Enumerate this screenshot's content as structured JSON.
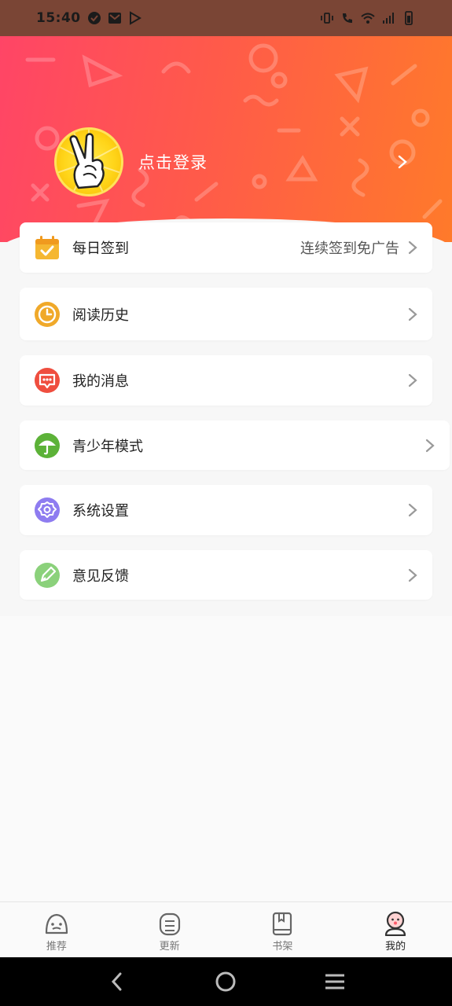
{
  "status_bar": {
    "time": "15:40",
    "left_icons": [
      "check-circle-icon",
      "mail-icon",
      "play-store-icon"
    ],
    "right_icons": [
      "vibrate-icon",
      "wifi-call-icon",
      "wifi-icon",
      "signal-icon",
      "battery-icon"
    ]
  },
  "header": {
    "login_text": "点击登录",
    "avatar": "peace-hand-avatar",
    "gradient_start": "#ff4566",
    "gradient_end": "#ff7a2a"
  },
  "menu": [
    {
      "label": "每日签到",
      "sub": "连续签到免广告",
      "icon": "calendar-check-icon",
      "color": "#f5b731"
    },
    {
      "label": "阅读历史",
      "sub": "",
      "icon": "clock-icon",
      "color": "#f0a92a"
    },
    {
      "label": "我的消息",
      "sub": "",
      "icon": "message-icon",
      "color": "#ef4e3f"
    },
    {
      "label": "青少年模式",
      "sub": "",
      "icon": "umbrella-icon",
      "color": "#5cb238"
    },
    {
      "label": "系统设置",
      "sub": "",
      "icon": "gear-icon",
      "color": "#8e7cf0"
    },
    {
      "label": "意见反馈",
      "sub": "",
      "icon": "feedback-icon",
      "color": "#8bd17b"
    }
  ],
  "tabs": [
    {
      "label": "推荐",
      "icon": "recommend-icon",
      "active": false
    },
    {
      "label": "更新",
      "icon": "update-icon",
      "active": false
    },
    {
      "label": "书架",
      "icon": "bookshelf-icon",
      "active": false
    },
    {
      "label": "我的",
      "icon": "profile-icon",
      "active": true
    }
  ],
  "nav": [
    "back-icon",
    "home-icon",
    "recents-icon"
  ]
}
